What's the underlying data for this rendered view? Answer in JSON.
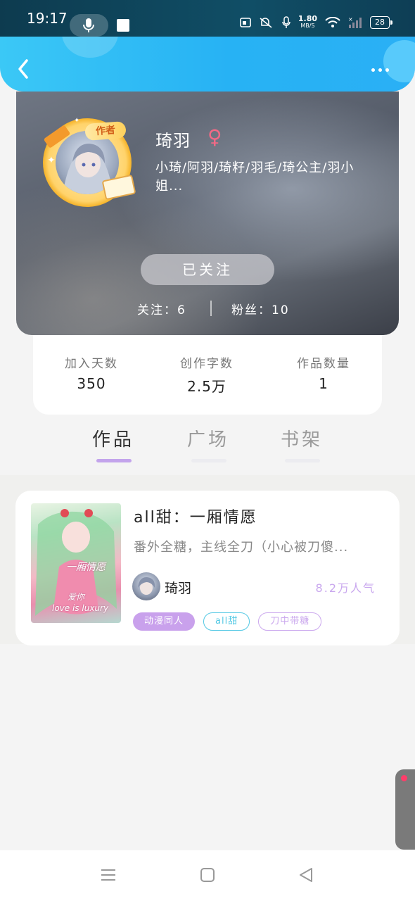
{
  "status_bar": {
    "time": "19:17",
    "net_speed_value": "1.80",
    "net_speed_unit": "MB/S",
    "battery": "28",
    "icons": [
      "mic-icon",
      "stop-icon",
      "nfc-icon",
      "mute-icon",
      "mic-small-icon",
      "wifi-icon",
      "signal-icon",
      "battery-icon"
    ]
  },
  "header": {
    "back_icon": "chevron-left-icon",
    "more_icon": "more-dots-icon",
    "accent_color": "#2ab0f5"
  },
  "profile": {
    "badge": "作者",
    "name": "琦羽",
    "gender_symbol": "♀",
    "aliases": "小琦/阿羽/琦籽/羽毛/琦公主/羽小姐...",
    "follow_button": "已关注",
    "following": "关注：6",
    "followers": "粉丝：10"
  },
  "stats": [
    {
      "label": "加入天数",
      "value": "350"
    },
    {
      "label": "创作字数",
      "value": "2.5万"
    },
    {
      "label": "作品数量",
      "value": "1"
    }
  ],
  "tabs": [
    {
      "label": "作品",
      "active": true
    },
    {
      "label": "广场",
      "active": false
    },
    {
      "label": "书架",
      "active": false
    }
  ],
  "work": {
    "title": "all甜：一厢情愿",
    "description": "番外全糖，主线全刀（小心被刀傻...",
    "author": "琦羽",
    "popularity": "8.2万人气",
    "tags": [
      "动漫同人",
      "all甜",
      "刀中带糖"
    ]
  },
  "navbar": {
    "icons": [
      "menu-icon",
      "home-square-icon",
      "back-triangle-icon"
    ]
  }
}
